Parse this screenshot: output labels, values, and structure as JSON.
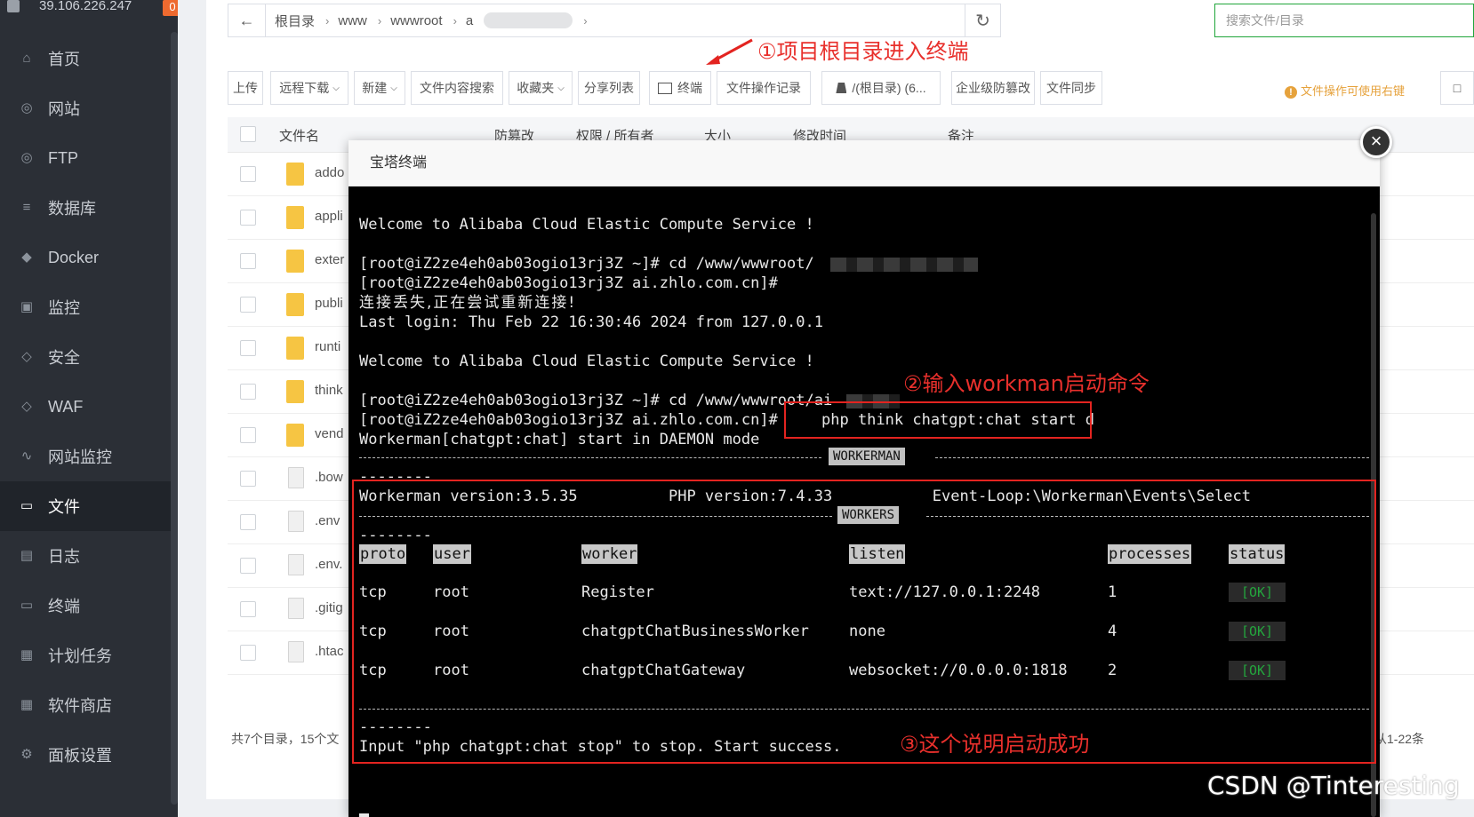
{
  "sidebar": {
    "host": "39.106.226.247",
    "badge": "0",
    "items": [
      {
        "label": "首页",
        "icon": "home-icon",
        "glyph": "⌂"
      },
      {
        "label": "网站",
        "icon": "globe-icon",
        "glyph": "◎"
      },
      {
        "label": "FTP",
        "icon": "ftp-icon",
        "glyph": "◎"
      },
      {
        "label": "数据库",
        "icon": "database-icon",
        "glyph": "≡"
      },
      {
        "label": "Docker",
        "icon": "docker-icon",
        "glyph": "◆"
      },
      {
        "label": "监控",
        "icon": "monitor-icon",
        "glyph": "▣"
      },
      {
        "label": "安全",
        "icon": "shield-icon",
        "glyph": "◇"
      },
      {
        "label": "WAF",
        "icon": "waf-icon",
        "glyph": "◇"
      },
      {
        "label": "网站监控",
        "icon": "chart-icon",
        "glyph": "∿"
      },
      {
        "label": "文件",
        "icon": "folder-icon",
        "glyph": "▭"
      },
      {
        "label": "日志",
        "icon": "log-icon",
        "glyph": "▤"
      },
      {
        "label": "终端",
        "icon": "terminal-icon",
        "glyph": "▭"
      },
      {
        "label": "计划任务",
        "icon": "calendar-icon",
        "glyph": "▦"
      },
      {
        "label": "软件商店",
        "icon": "apps-icon",
        "glyph": "▦"
      },
      {
        "label": "面板设置",
        "icon": "gear-icon",
        "glyph": "⚙"
      }
    ]
  },
  "pathbar": {
    "crumbs": [
      "根目录",
      "www",
      "wwwroot",
      "a"
    ]
  },
  "search": {
    "placeholder": "搜索文件/目录"
  },
  "annotations": {
    "a1": "①项目根目录进入终端",
    "a2": "②输入workman启动命令",
    "a3": "③这个说明启动成功"
  },
  "toolbar": {
    "upload": "上传",
    "remote_download": "远程下载",
    "new": "新建",
    "content_search": "文件内容搜索",
    "favorites": "收藏夹",
    "share_list": "分享列表",
    "terminal": "终端",
    "op_log": "文件操作记录",
    "disk": "/(根目录) (6...",
    "tamper": "企业级防篡改",
    "sync": "文件同步",
    "tip": "文件操作可使用右键"
  },
  "table": {
    "headers": {
      "name": "文件名",
      "tamper": "防篡改",
      "perm": "权限 / 所有者",
      "size": "大小",
      "mtime": "修改时间",
      "note": "备注"
    },
    "rows": [
      {
        "name": "addo",
        "type": "folder"
      },
      {
        "name": "appli",
        "type": "folder"
      },
      {
        "name": "exter",
        "type": "folder"
      },
      {
        "name": "publi",
        "type": "folder"
      },
      {
        "name": "runti",
        "type": "folder"
      },
      {
        "name": "think",
        "type": "folder"
      },
      {
        "name": "vend",
        "type": "folder"
      },
      {
        "name": ".bow",
        "type": "file"
      },
      {
        "name": ".env",
        "type": "file"
      },
      {
        "name": ".env.",
        "type": "file"
      },
      {
        "name": ".gitig",
        "type": "file"
      },
      {
        "name": ".htac",
        "type": "file"
      }
    ],
    "footer_left": "共7个目录，15个文",
    "footer_right": "从1-22条"
  },
  "modal": {
    "title": "宝塔终端",
    "lines": {
      "welcome1": "Welcome to Alibaba Cloud Elastic Compute Service !",
      "cd1": "[root@iZ2ze4eh0ab03ogio13rj3Z ~]# cd /www/wwwroot/",
      "prompt1": "[root@iZ2ze4eh0ab03ogio13rj3Z ai.zhlo.com.cn]#",
      "reconnect": "连接丢失,正在尝试重新连接!",
      "lastlogin": "Last login: Thu Feb 22 16:30:46 2024 from 127.0.0.1",
      "welcome2": "Welcome to Alibaba Cloud Elastic Compute Service !",
      "cd2": "[root@iZ2ze4eh0ab03ogio13rj3Z ~]# cd /www/wwwroot/ai",
      "prompt2": "[root@iZ2ze4eh0ab03ogio13rj3Z ai.zhlo.com.cn]#",
      "command": "php think chatgpt:chat start d",
      "daemon": "Workerman[chatgpt:chat] start in DAEMON mode",
      "workerman_tag": "WORKERMAN",
      "dashes_short": "--------",
      "versions": "Workerman version:3.5.35          PHP version:7.4.33           Event-Loop:\\Workerman\\Events\\Select",
      "workers_tag": "WORKERS",
      "stop": "Input \"php chatgpt:chat stop\" to stop. Start success."
    },
    "workers_headers": [
      "proto",
      "user",
      "worker",
      "listen",
      "processes",
      "status"
    ],
    "workers": [
      {
        "proto": "tcp",
        "user": "root",
        "worker": "Register",
        "listen": "text://127.0.0.1:2248",
        "processes": "1",
        "status": "[OK]"
      },
      {
        "proto": "tcp",
        "user": "root",
        "worker": "chatgptChatBusinessWorker",
        "listen": "none",
        "processes": "4",
        "status": "[OK]"
      },
      {
        "proto": "tcp",
        "user": "root",
        "worker": "chatgptChatGateway",
        "listen": "websocket://0.0.0.0:1818",
        "processes": "2",
        "status": "[OK]"
      }
    ]
  },
  "watermark": "CSDN @Tinteresting",
  "colors": {
    "accent": "#20a53a",
    "annotation": "#e32420",
    "ok": "#24a53d",
    "sidebar": "#2b2f36"
  }
}
